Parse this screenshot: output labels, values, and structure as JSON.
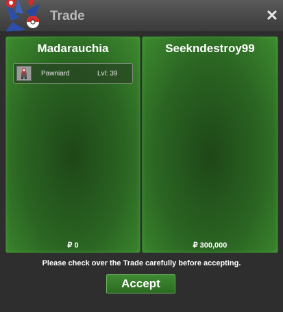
{
  "window": {
    "title": "Trade",
    "close_symbol": "✕"
  },
  "left_panel": {
    "player_name": "Madarauchia",
    "money": "₽ 0",
    "items": [
      {
        "icon": "pawniard-sprite-icon",
        "name": "Pawniard",
        "level": "Lvl: 39"
      }
    ]
  },
  "right_panel": {
    "player_name": "Seekndestroy99",
    "money": "₽ 300,000",
    "items": []
  },
  "notice": "Please check over the Trade carefully before accepting.",
  "accept_label": "Accept",
  "colors": {
    "panel_green": "#2a6422",
    "accept_green": "#3f8b32",
    "titlebar": "#4a4a4a"
  }
}
